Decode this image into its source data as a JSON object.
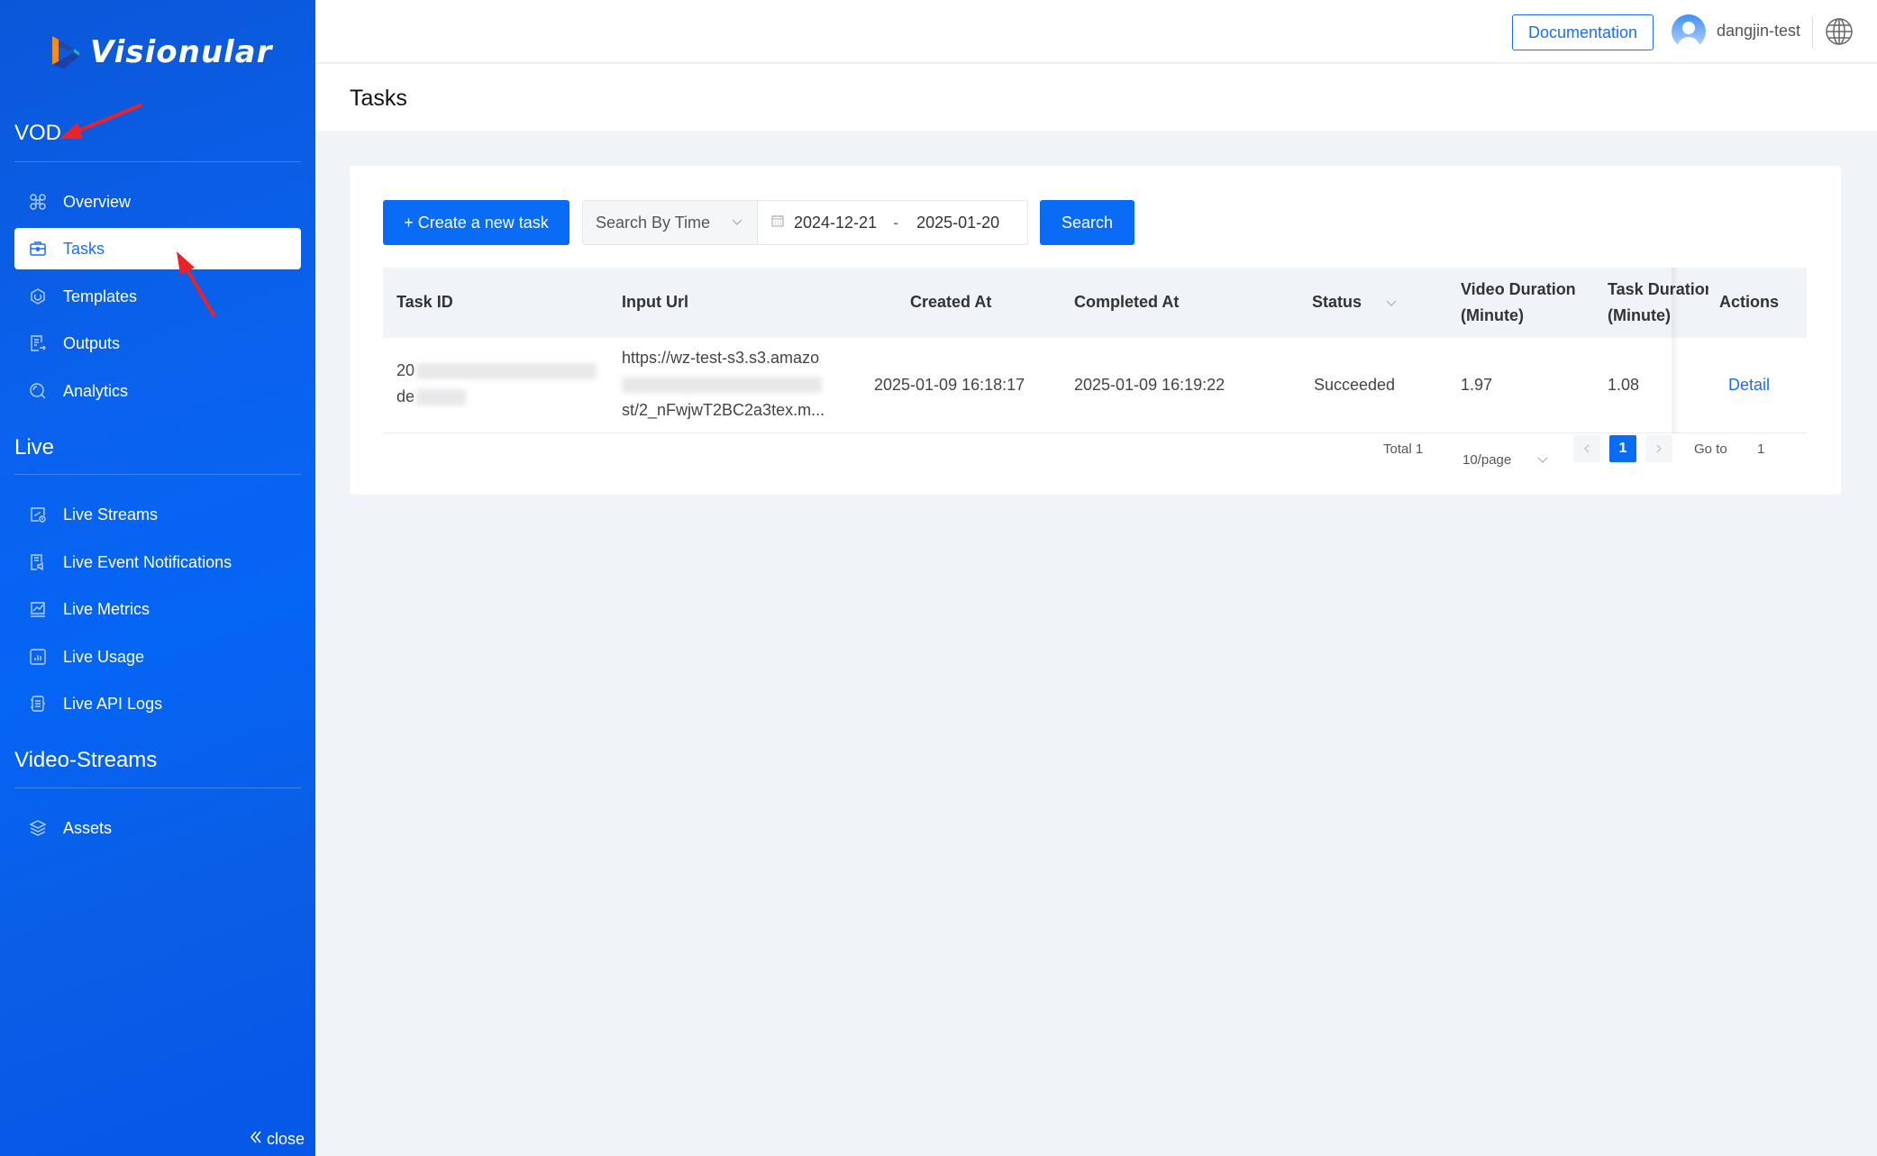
{
  "brand": {
    "name": "Visionular"
  },
  "sidebar": {
    "sections": [
      {
        "title": "VOD",
        "items": [
          {
            "label": "Overview",
            "icon": "command-icon"
          },
          {
            "label": "Tasks",
            "icon": "briefcase-icon",
            "active": true
          },
          {
            "label": "Templates",
            "icon": "hexagon-icon"
          },
          {
            "label": "Outputs",
            "icon": "document-export-icon"
          },
          {
            "label": "Analytics",
            "icon": "magnifier-icon"
          }
        ]
      },
      {
        "title": "Live",
        "items": [
          {
            "label": "Live Streams",
            "icon": "stream-clock-icon"
          },
          {
            "label": "Live Event Notifications",
            "icon": "notification-doc-icon"
          },
          {
            "label": "Live Metrics",
            "icon": "line-chart-icon"
          },
          {
            "label": "Live Usage",
            "icon": "bar-chart-icon"
          },
          {
            "label": "Live API Logs",
            "icon": "log-list-icon"
          }
        ]
      },
      {
        "title": "Video-Streams",
        "items": [
          {
            "label": "Assets",
            "icon": "layers-icon"
          }
        ]
      }
    ],
    "close_label": "close"
  },
  "topbar": {
    "documentation_label": "Documentation",
    "username": "dangjin-test"
  },
  "page": {
    "title": "Tasks"
  },
  "toolbar": {
    "create_label": "+ Create a new task",
    "filter_type": "Search By Time",
    "date_start": "2024-12-21",
    "date_separator": "-",
    "date_end": "2025-01-20",
    "search_label": "Search"
  },
  "table": {
    "columns": {
      "task_id": "Task ID",
      "input_url": "Input Url",
      "created_at": "Created At",
      "completed_at": "Completed At",
      "status": "Status",
      "video_duration_1": "Video Duration",
      "video_duration_2": "(Minute)",
      "task_duration_1": "Task Duration",
      "task_duration_2": "(Minute)",
      "actions": "Actions"
    },
    "rows": [
      {
        "task_id_line1": "20",
        "task_id_line2": "de",
        "input_url_line1": "https://wz-test-s3.s3.amazo",
        "input_url_line3": "st/2_nFwjwT2BC2a3tex.m...",
        "created_at": "2025-01-09 16:18:17",
        "completed_at": "2025-01-09 16:19:22",
        "status": "Succeeded",
        "video_duration": "1.97",
        "task_duration": "1.08",
        "action": "Detail"
      }
    ]
  },
  "pagination": {
    "total_label": "Total 1",
    "page_size": "10/page",
    "current_page": "1",
    "goto_label": "Go to",
    "goto_value": "1"
  },
  "colors": {
    "primary": "#0a6cf5",
    "sidebar": "#0a62ee",
    "annotation": "#e8232a"
  }
}
